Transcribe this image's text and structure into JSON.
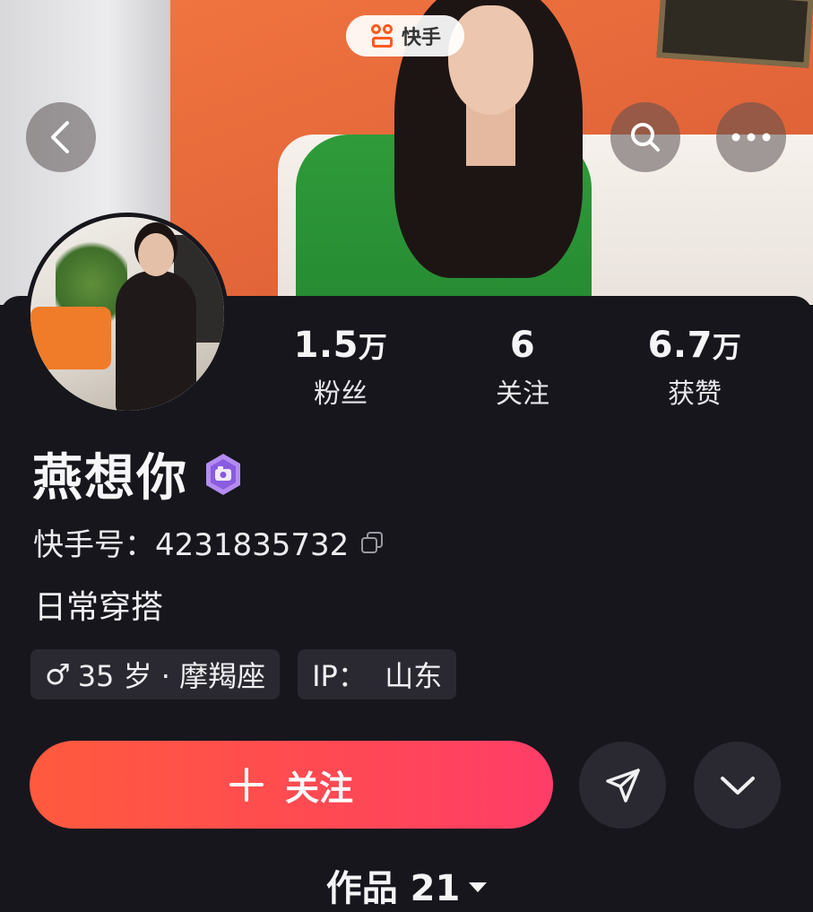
{
  "app_badge": {
    "label": "快手",
    "icon": "kuaishou-logo-icon"
  },
  "header": {
    "back_icon": "chevron-left-icon",
    "search_icon": "search-icon",
    "more_icon": "more-dots-icon"
  },
  "stats": [
    {
      "value": "1.5",
      "unit": "万",
      "label": "粉丝"
    },
    {
      "value": "6",
      "unit": "",
      "label": "关注"
    },
    {
      "value": "6.7",
      "unit": "万",
      "label": "获赞"
    }
  ],
  "profile": {
    "name": "燕想你",
    "badge_icon": "creator-badge-icon",
    "kuaishou_id": "快手号：4231835732",
    "copy_icon": "copy-icon",
    "bio": "日常穿搭",
    "tags": [
      {
        "icon": "male-symbol-icon",
        "symbol": "♂",
        "text": "35 岁 · 摩羯座"
      },
      {
        "text": "IP：  山东"
      }
    ]
  },
  "actions": {
    "follow_label": "关注",
    "share_icon": "send-icon",
    "expand_icon": "chevron-down-icon"
  },
  "works_tab": {
    "label": "作品 21"
  },
  "colors": {
    "background": "#17161d",
    "follow_gradient_start": "#ff5a3e",
    "follow_gradient_end": "#ff3d68",
    "tag_bg": "#2a2931",
    "badge_purple": "#a070e8"
  }
}
